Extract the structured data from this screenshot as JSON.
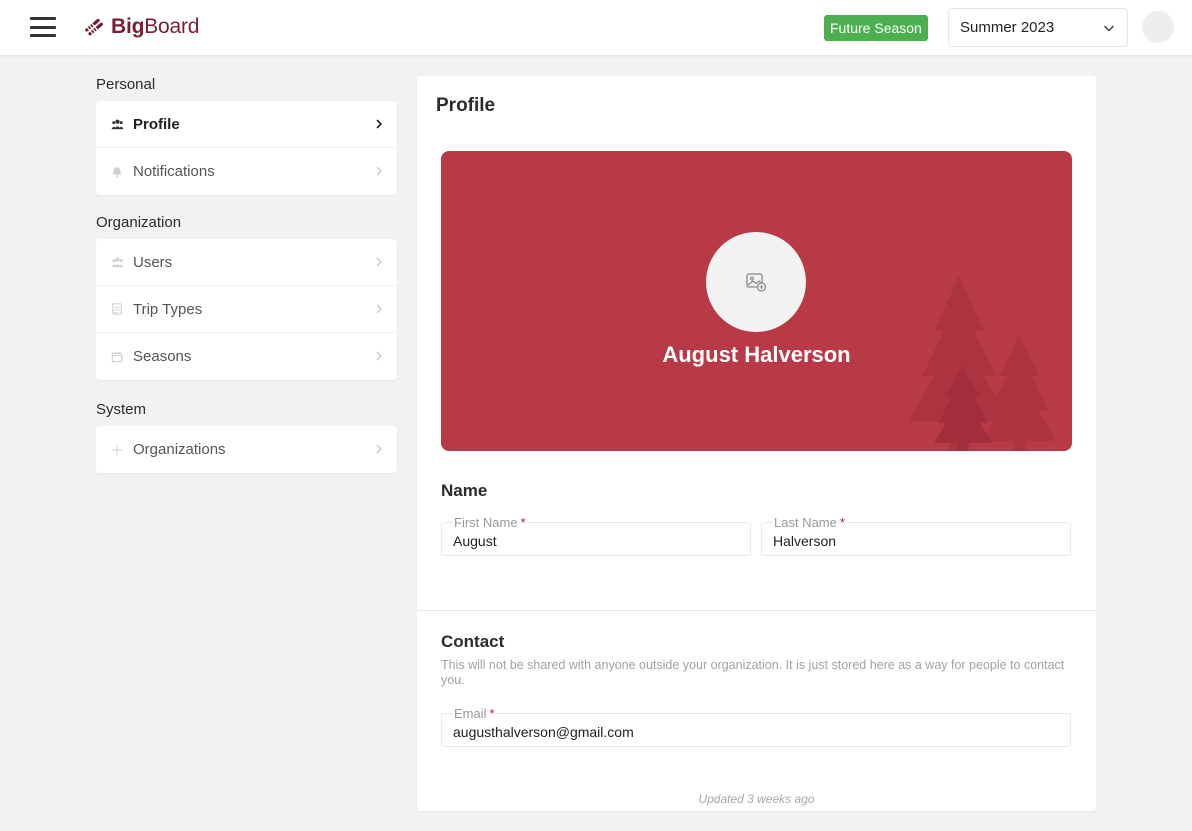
{
  "header": {
    "logo_bold": "Big",
    "logo_light": "Board",
    "season_badge": "Future Season",
    "season_select": "Summer 2023"
  },
  "sidebar": {
    "sections": [
      {
        "title": "Personal",
        "items": [
          {
            "label": "Profile",
            "icon": "users-icon",
            "active": true
          },
          {
            "label": "Notifications",
            "icon": "bell-icon",
            "active": false
          }
        ]
      },
      {
        "title": "Organization",
        "items": [
          {
            "label": "Users",
            "icon": "users-icon",
            "active": false
          },
          {
            "label": "Trip Types",
            "icon": "document-icon",
            "active": false
          },
          {
            "label": "Seasons",
            "icon": "calendar-icon",
            "active": false
          }
        ]
      },
      {
        "title": "System",
        "items": [
          {
            "label": "Organizations",
            "icon": "plus-icon",
            "active": false
          }
        ]
      }
    ]
  },
  "profile": {
    "title": "Profile",
    "display_name": "August Halverson",
    "name_section": {
      "title": "Name",
      "first_name_label": "First Name",
      "first_name": "August",
      "last_name_label": "Last Name",
      "last_name": "Halverson",
      "required_marker": "*"
    },
    "contact_section": {
      "title": "Contact",
      "description": "This will not be shared with anyone outside your organization. It is just stored here as a way for people to contact you.",
      "email_label": "Email",
      "email": "augusthalverson@gmail.com",
      "required_marker": "*"
    },
    "updated": "Updated 3 weeks ago"
  },
  "colors": {
    "brand": "#7a1f33",
    "banner": "#b73a46",
    "badge": "#4caf50",
    "required": "#c0162a"
  }
}
